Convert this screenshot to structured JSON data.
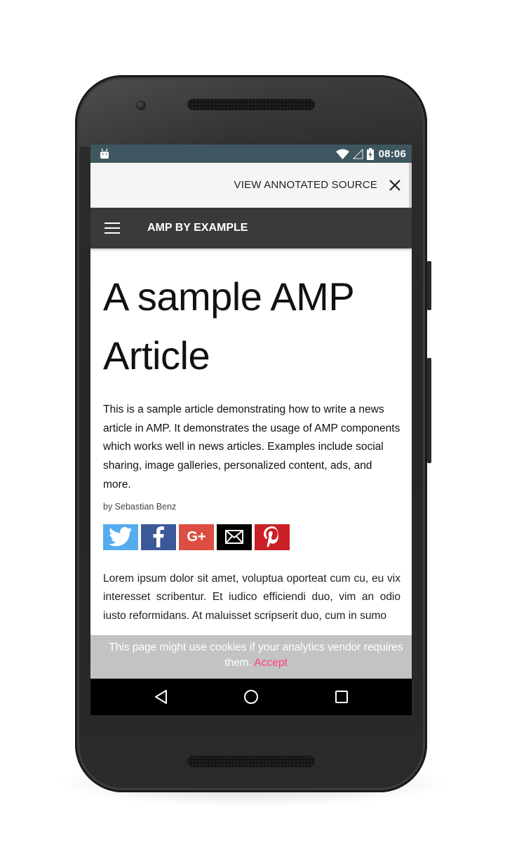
{
  "status_bar": {
    "time": "08:06",
    "icons": [
      "android-debug-icon",
      "wifi-icon",
      "cell-signal-icon",
      "battery-charging-icon"
    ]
  },
  "annotated_bar": {
    "link_label": "VIEW ANNOTATED SOURCE",
    "close_icon": "close-icon"
  },
  "header": {
    "menu_icon": "hamburger-menu-icon",
    "title": "AMP BY EXAMPLE",
    "background": "#3a3a3a"
  },
  "article": {
    "title": "A sample AMP Article",
    "lead": "This is a sample article demonstrating how to write a news article in AMP. It demonstrates the usage of AMP components which works well in news articles. Examples include social sharing, image galleries, personalized content, ads, and more.",
    "byline": "by Sebastian Benz",
    "share_buttons": [
      {
        "network": "twitter",
        "icon": "twitter-icon",
        "color": "#55acee"
      },
      {
        "network": "facebook",
        "icon": "facebook-icon",
        "color": "#3b5998"
      },
      {
        "network": "gplus",
        "icon": "google-plus-icon",
        "label": "G+",
        "color": "#dc4e41"
      },
      {
        "network": "email",
        "icon": "email-icon",
        "color": "#000000"
      },
      {
        "network": "pinterest",
        "icon": "pinterest-icon",
        "color": "#cb2027"
      }
    ],
    "body": "Lorem ipsum dolor sit amet, voluptua oporteat cum cu, eu vix interesset scribentur. Et iudico efficiendi duo, vim an odio iusto reformidans. At maluisset scripserit duo, cum in sumo"
  },
  "cookie_banner": {
    "message": "This page might use cookies if your analytics vendor requires them.",
    "accept_label": "Accept",
    "accent_color": "#ff4081"
  },
  "nav_bar": {
    "buttons": [
      "back-icon",
      "home-icon",
      "recents-icon"
    ]
  }
}
